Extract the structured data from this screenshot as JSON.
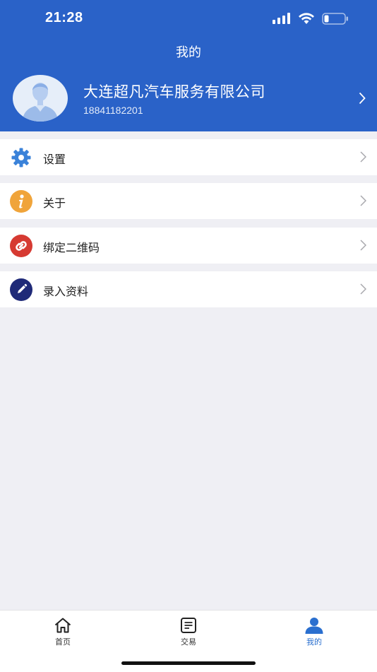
{
  "status_bar": {
    "time": "21:28"
  },
  "header": {
    "title": "我的"
  },
  "profile": {
    "company": "大连超凡汽车服务有限公司",
    "phone": "18841182201"
  },
  "menu": [
    {
      "label": "设置",
      "icon": "gear-icon",
      "color": "#3a82d9"
    },
    {
      "label": "关于",
      "icon": "info-icon",
      "color": "#f0a43a"
    },
    {
      "label": "绑定二维码",
      "icon": "link-icon",
      "color": "#d63a32"
    },
    {
      "label": "录入资料",
      "icon": "pencil-icon",
      "color": "#1f2a78"
    }
  ],
  "tabs": [
    {
      "label": "首页",
      "icon": "home-icon"
    },
    {
      "label": "交易",
      "icon": "document-icon"
    },
    {
      "label": "我的",
      "icon": "user-icon",
      "active": true
    }
  ],
  "colors": {
    "header_bg": "#2a62c8",
    "active_tab": "#2a6fcf",
    "page_bg": "#efeff4"
  }
}
